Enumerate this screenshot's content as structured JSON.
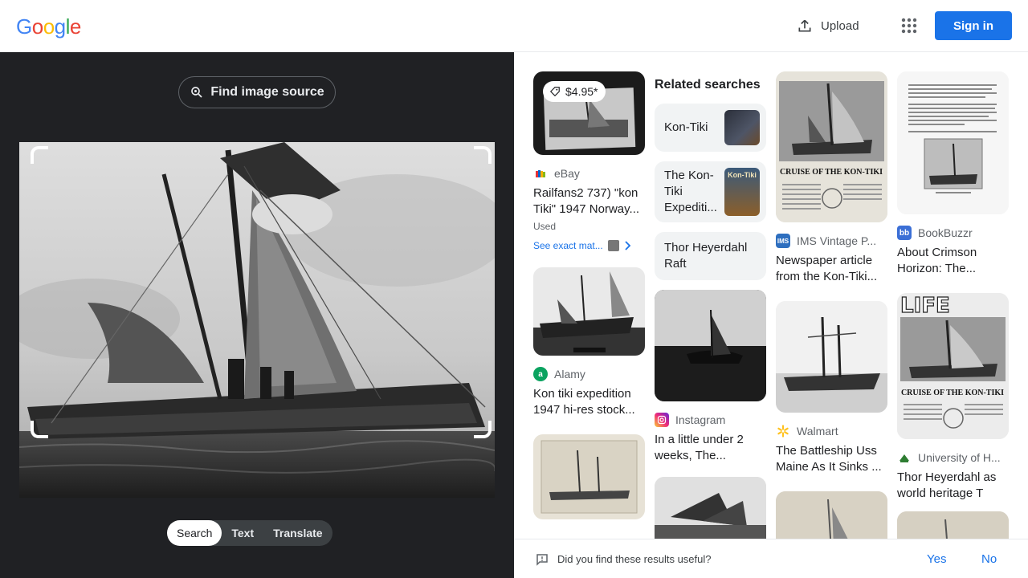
{
  "header": {
    "logo_letters": [
      "G",
      "o",
      "o",
      "g",
      "l",
      "e"
    ],
    "upload_label": "Upload",
    "signin_label": "Sign in"
  },
  "left": {
    "find_source_label": "Find image source",
    "tabs": [
      "Search",
      "Text",
      "Translate"
    ],
    "active_tab": "Search"
  },
  "results": {
    "col1": [
      {
        "price": "$4.95*",
        "source": "eBay",
        "title": "Railfans2 737) \"kon Tiki\" 1947 Norway...",
        "condition": "Used",
        "exact_match": "See exact mat..."
      },
      {
        "source": "Alamy",
        "title": "Kon tiki expedition 1947 hi-res stock..."
      }
    ],
    "col2": {
      "related_heading": "Related searches",
      "related": [
        "Kon-Tiki",
        "The Kon-Tiki Expediti...",
        "Thor Heyerdahl Raft"
      ],
      "items": [
        {
          "source": "Instagram",
          "title": "In a little under 2 weeks, The..."
        }
      ]
    },
    "col3": [
      {
        "source": "IMS Vintage P...",
        "title": "Newspaper article from the Kon-Tiki..."
      },
      {
        "source": "Walmart",
        "title": "The Battleship Uss Maine As It Sinks ..."
      }
    ],
    "col4": [
      {
        "source": "BookBuzzr",
        "title": "About Crimson Horizon: The..."
      },
      {
        "source": "University of H...",
        "title": "Thor Heyerdahl as world heritage T"
      }
    ],
    "thumb_texts": {
      "newspaper_headline": "CRUISE OF THE KON-TIKI",
      "magazine_name": "LIFE",
      "kon_tiki_book": "Kon-Tiki"
    }
  },
  "feedback": {
    "question": "Did you find these results useful?",
    "yes": "Yes",
    "no": "No"
  },
  "colors": {
    "accent": "#1a73e8",
    "dark_panel": "#202124"
  }
}
